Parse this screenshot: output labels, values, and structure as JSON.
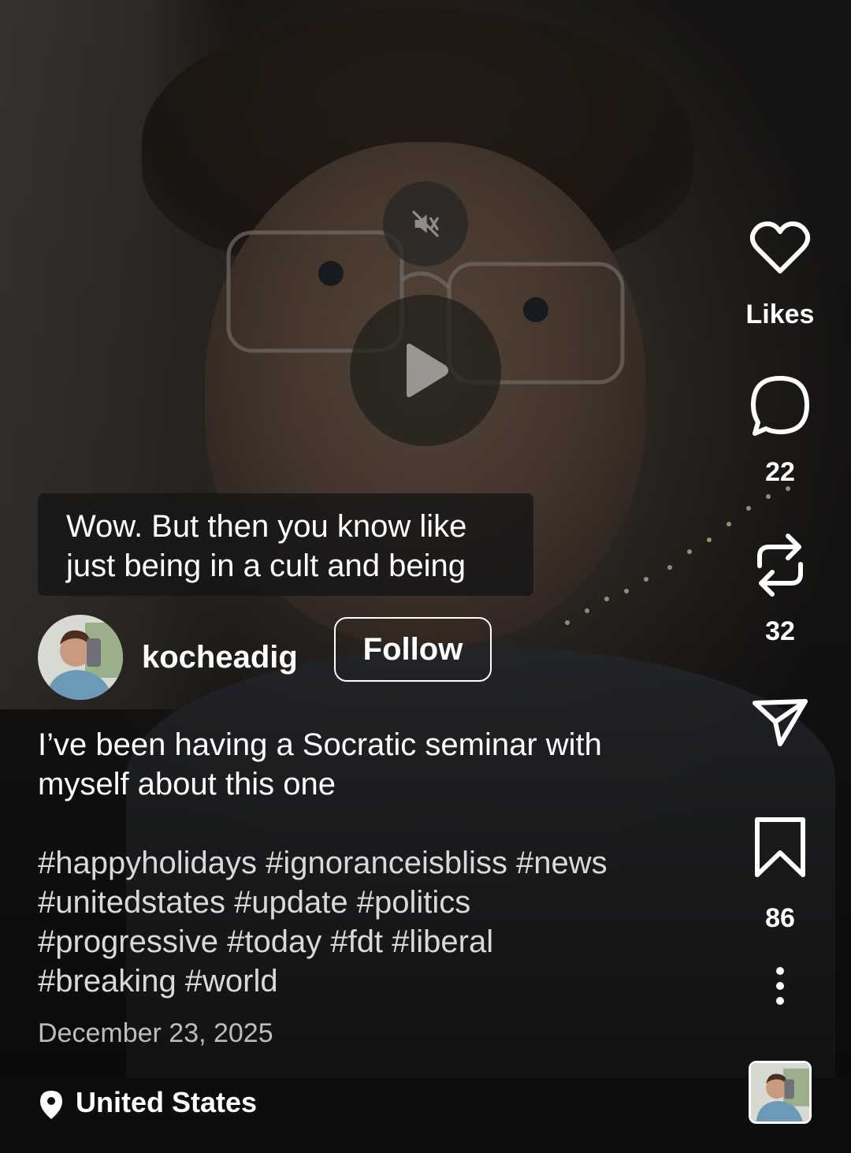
{
  "caption": {
    "lines": [
      "Wow. But then you know like",
      "just being in a cult and being"
    ]
  },
  "author": {
    "username": "kocheadig",
    "follow_label": "Follow",
    "avatar_icon": "user-avatar"
  },
  "post": {
    "description_lines": [
      "I’ve been having a Socratic seminar with",
      "myself about this one"
    ],
    "hashtag_lines": [
      "#happyholidays #ignoranceisbliss #news",
      "#unitedstates #update #politics",
      "#progressive #today #fdt #liberal",
      "#breaking #world"
    ],
    "date": "December 23, 2025"
  },
  "location": {
    "label": "United States",
    "icon": "location-pin-icon"
  },
  "actions": {
    "likes_label": "Likes",
    "comments_count": "22",
    "reposts_count": "32",
    "saves_count": "86"
  },
  "player": {
    "muted": true,
    "paused": true
  },
  "colors": {
    "text": "#ffffff",
    "tag_text": "#d9d9d9",
    "date_text": "#bdbdbd",
    "bottom_bar": "#0d0d0d"
  }
}
